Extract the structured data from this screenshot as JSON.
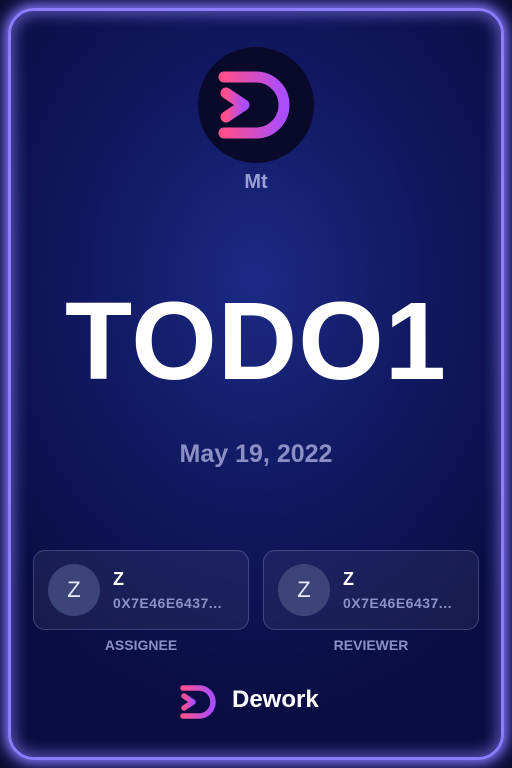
{
  "org": {
    "name": "Mt",
    "logo_icon": "dework-logo-icon"
  },
  "task": {
    "title": "TODO1",
    "date": "May 19, 2022"
  },
  "assignee": {
    "avatar_initial": "Z",
    "name": "Z",
    "address": "0X7E46E6437...",
    "role_label": "ASSIGNEE"
  },
  "reviewer": {
    "avatar_initial": "Z",
    "name": "Z",
    "address": "0X7E46E6437...",
    "role_label": "REVIEWER"
  },
  "brand": {
    "name": "Dework",
    "logo_icon": "dework-logo-icon"
  },
  "colors": {
    "frame_glow": "#8c7cff",
    "logo_gradient_start": "#ff4f8b",
    "logo_gradient_end": "#a94dff",
    "background": "#111a63"
  }
}
